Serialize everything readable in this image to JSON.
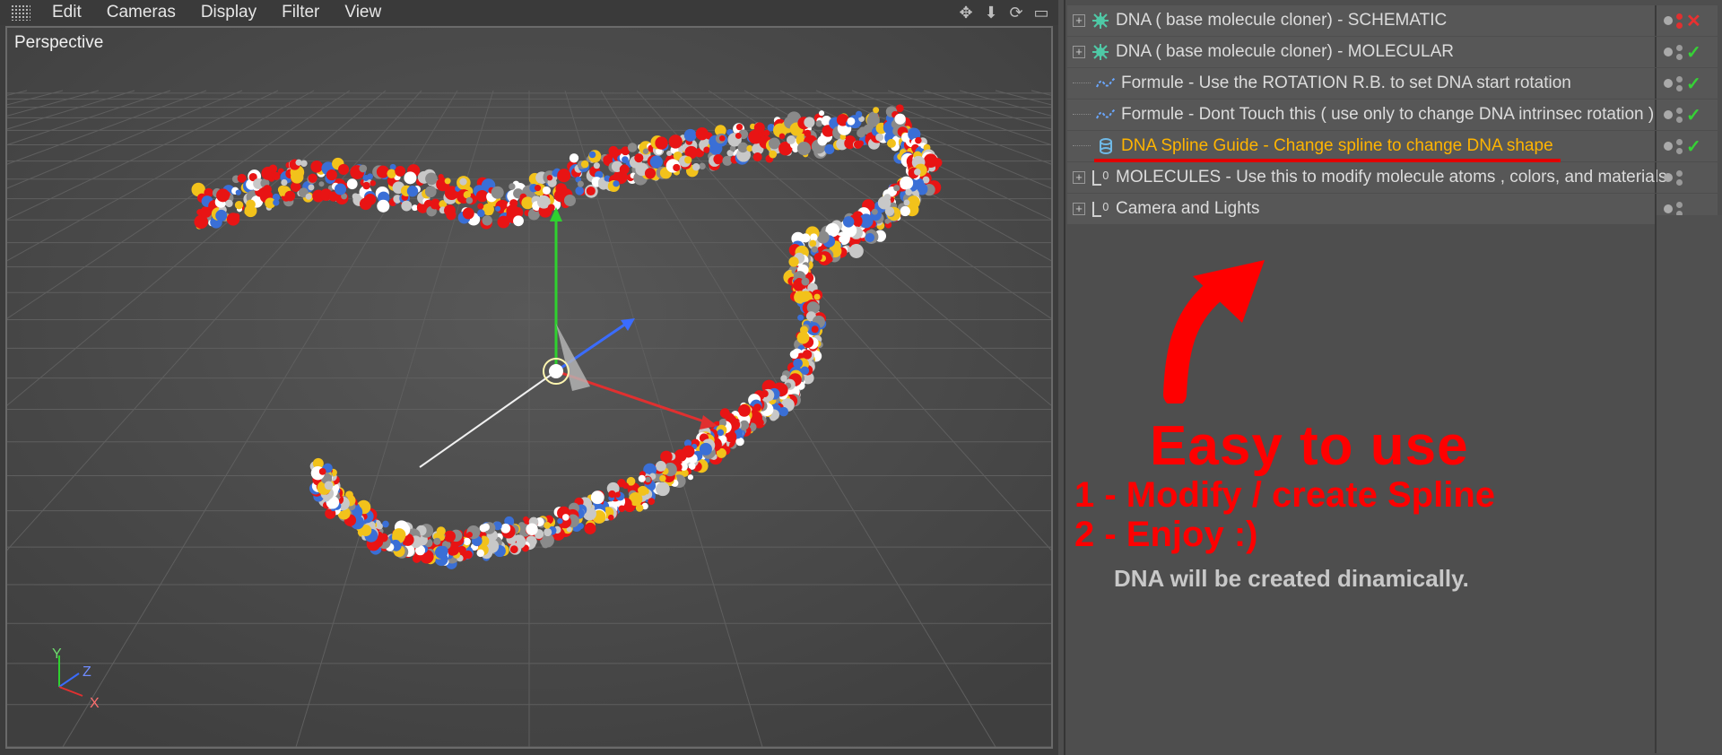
{
  "menubar": {
    "items": [
      "Edit",
      "Cameras",
      "Display",
      "Filter",
      "View"
    ]
  },
  "viewport": {
    "label": "Perspective",
    "axis_labels": {
      "x": "X",
      "y": "Y",
      "z": "Z"
    }
  },
  "objects": [
    {
      "label": "DNA  ( base  molecule cloner) - SCHEMATIC",
      "icon": "cloner-icon",
      "expandable": true,
      "enabled": "cross"
    },
    {
      "label": "DNA  ( base  molecule cloner) - MOLECULAR",
      "icon": "cloner-icon",
      "expandable": true,
      "enabled": "check"
    },
    {
      "label": "Formule - Use the ROTATION R.B.  to set DNA  start rotation",
      "icon": "formula-icon",
      "expandable": false,
      "enabled": "check"
    },
    {
      "label": "Formule - Dont Touch this ( use only to change DNA intrinsec rotation )",
      "icon": "formula-icon",
      "expandable": false,
      "enabled": "check"
    },
    {
      "label": "DNA Spline Guide - Change spline to change  DNA  shape",
      "icon": "spline-icon",
      "expandable": false,
      "enabled": "check",
      "highlight": true
    },
    {
      "label": "MOLECULES - Use this to modify molecule atoms , colors, and materials",
      "icon": "null-icon",
      "expandable": true,
      "enabled": "none"
    },
    {
      "label": "Camera and Lights",
      "icon": "null-icon",
      "expandable": true,
      "enabled": "none"
    }
  ],
  "promo": {
    "title": "Easy to use",
    "step1": "1 - Modify / create Spline",
    "step2": "2 - Enjoy :)",
    "note": "DNA will be created dinamically."
  },
  "colors": {
    "accent_red": "#ff0000",
    "highlight_orange": "#ffb400",
    "check_green": "#36d136"
  }
}
